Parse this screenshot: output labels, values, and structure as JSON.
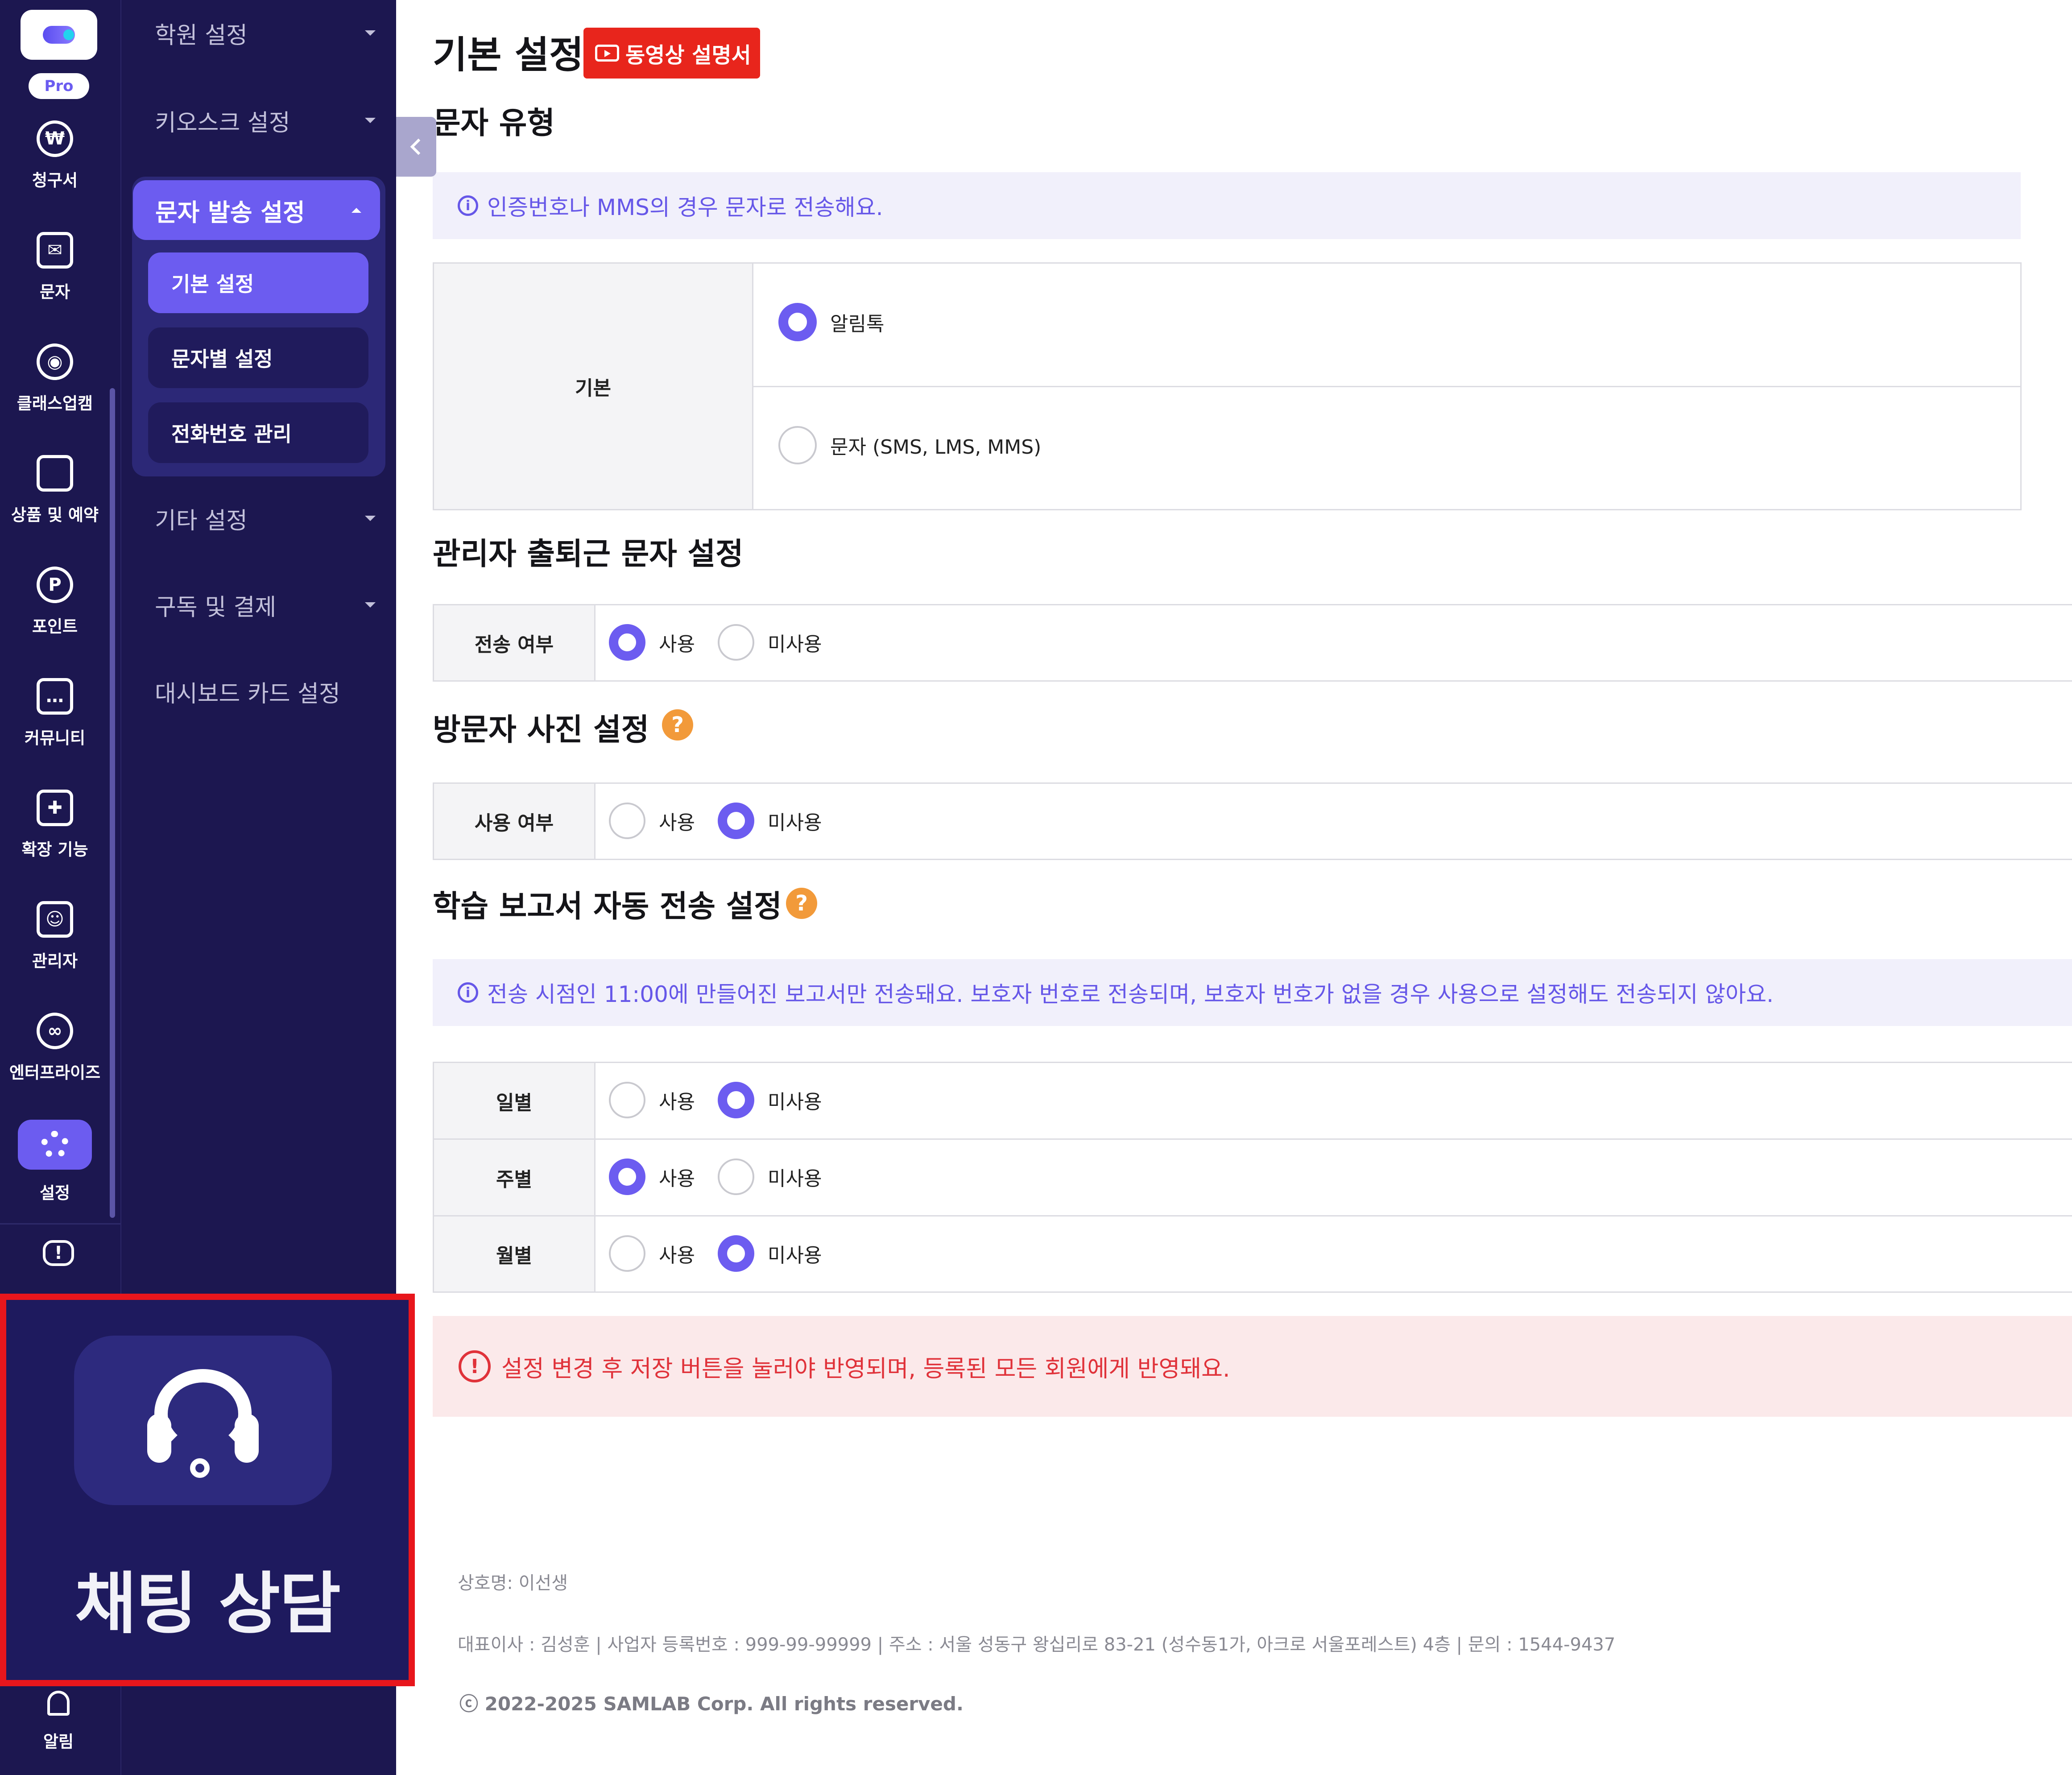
{
  "rail": {
    "pro_badge": "Pro",
    "items": [
      {
        "label": "청구서",
        "icon": "won-icon",
        "glyph": "₩"
      },
      {
        "label": "문자",
        "icon": "mail-icon",
        "glyph": "✉"
      },
      {
        "label": "클래스업캠",
        "icon": "webcam-icon",
        "glyph": "◉"
      },
      {
        "label": "상품 및 예약",
        "icon": "shopping-bag-icon",
        "glyph": ""
      },
      {
        "label": "포인트",
        "icon": "point-icon",
        "glyph": "P"
      },
      {
        "label": "커뮤니티",
        "icon": "chat-bubble-icon",
        "glyph": "…"
      },
      {
        "label": "확장 기능",
        "icon": "puzzle-icon",
        "glyph": "✚"
      },
      {
        "label": "관리자",
        "icon": "admin-icon",
        "glyph": "☺"
      },
      {
        "label": "엔터프라이즈",
        "icon": "enterprise-icon",
        "glyph": "∞"
      },
      {
        "label": "설정",
        "icon": "gear-icon",
        "glyph": ""
      }
    ],
    "info_glyph": "!",
    "chat": {
      "label": "채팅 상담",
      "icon": "headset-icon"
    },
    "alarm": {
      "label": "알림",
      "icon": "bell-icon"
    }
  },
  "submenu": {
    "academy": "학원 설정",
    "kiosk": "키오스크 설정",
    "sms_group": "문자 발송 설정",
    "sms_basic": "기본 설정",
    "sms_per_type": "문자별 설정",
    "sms_phone": "전화번호 관리",
    "etc": "기타 설정",
    "subscription": "구독 및 결제",
    "dashboard": "대시보드 카드 설정"
  },
  "main": {
    "title": "기본 설정",
    "video_button": "동영상 설명서",
    "message_type": {
      "title": "문자 유형",
      "info": "인증번호나 MMS의 경우 문자로 전송해요.",
      "row_label": "기본",
      "options": [
        "알림톡",
        "문자 (SMS, LMS, MMS)"
      ],
      "selected": "알림톡"
    },
    "admin_commute": {
      "title": "관리자 출퇴근 문자 설정",
      "row_label": "전송 여부",
      "options": [
        "사용",
        "미사용"
      ],
      "selected": "사용"
    },
    "visitor_photo": {
      "title": "방문자 사진 설정",
      "row_label": "사용 여부",
      "options": [
        "사용",
        "미사용"
      ],
      "selected": "미사용"
    },
    "report_auto": {
      "title": "학습 보고서 자동 전송 설정",
      "info": "전송 시점인 11:00에 만들어진 보고서만 전송돼요. 보호자 번호로 전송되며, 보호자 번호가 없을 경우 사용으로 설정해도 전송되지 않아요.",
      "rows": [
        {
          "label": "일별",
          "options": [
            "사용",
            "미사용"
          ],
          "selected": "미사용"
        },
        {
          "label": "주별",
          "options": [
            "사용",
            "미사용"
          ],
          "selected": "사용"
        },
        {
          "label": "월별",
          "options": [
            "사용",
            "미사용"
          ],
          "selected": "미사용"
        }
      ]
    },
    "help_glyph": "?",
    "info_glyph": "i",
    "warning_glyph": "!",
    "warning": "설정 변경 후 저장 버튼을 눌러야 반영되며, 등록된 모든 회원에게 반영돼요."
  },
  "footer": {
    "company": "상호명: 이선생",
    "details": "대표이사 : 김성훈  |  사업자 등록번호 : 999-99-99999  |  주소 : 서울 성동구 왕십리로 83-21 (성수동1가, 아크로 서울포레스트) 4층  |  문의 : 1544-9437",
    "copyright": "ⓒ 2022-2025 SAMLAB Corp. All rights reserved."
  },
  "colors": {
    "accent": "#6c5cf0",
    "nav_bg": "#1c1750",
    "video_red": "#e8251c",
    "warn_red": "#e0323a",
    "help_orange": "#f29a3a"
  }
}
